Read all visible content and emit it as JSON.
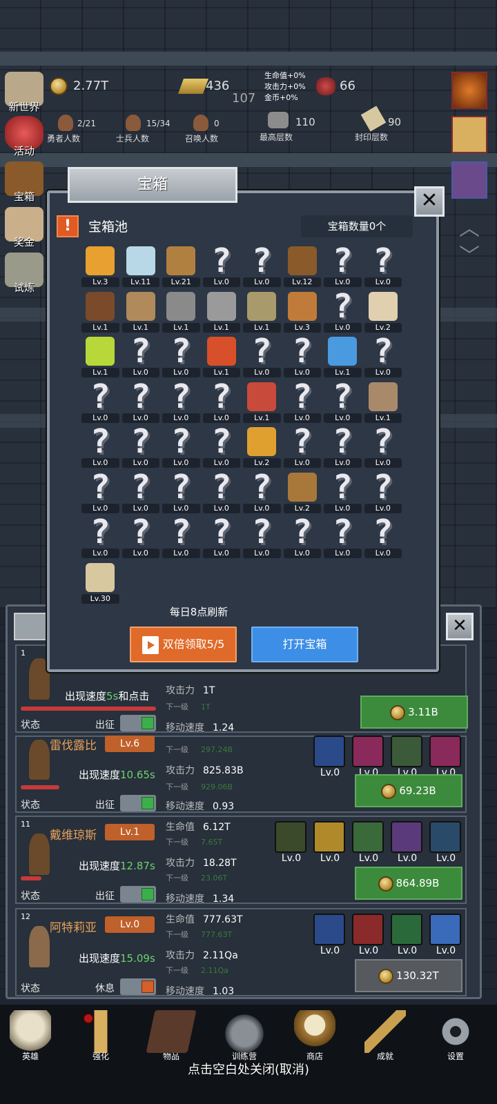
{
  "hud": {
    "gold": "2.77T",
    "bars": "436",
    "gems": "66",
    "mid_number": "107",
    "bonus": [
      "生命值+0%",
      "攻击力+0%",
      "金币+0%"
    ],
    "heroes": {
      "value": "2/21",
      "label": "勇者人数"
    },
    "soldiers": {
      "value": "15/34",
      "label": "士兵人数"
    },
    "summon": {
      "value": "0",
      "label": "召唤人数"
    },
    "max_floor": {
      "value": "110",
      "label": "最高层数"
    },
    "sealed_floor": {
      "value": "90",
      "label": "封印层数"
    }
  },
  "left_nav": [
    "新世界",
    "活动",
    "宝箱",
    "奖金",
    "试炼"
  ],
  "modal": {
    "title": "宝箱",
    "pool_label": "宝箱池",
    "count": "宝箱数量0个",
    "refresh": "每日8点刷新",
    "double_btn": "双倍领取5/5",
    "open_btn": "打开宝箱",
    "items": [
      {
        "icon": "crown-icon",
        "lv": "Lv.3"
      },
      {
        "icon": "diamond-icon",
        "lv": "Lv.11"
      },
      {
        "icon": "wooden-sword-icon",
        "lv": "Lv.21"
      },
      {
        "icon": "unknown-icon",
        "lv": "Lv.0"
      },
      {
        "icon": "unknown-icon",
        "lv": "Lv.0"
      },
      {
        "icon": "leather-armor-icon",
        "lv": "Lv.12"
      },
      {
        "icon": "unknown-icon",
        "lv": "Lv.0"
      },
      {
        "icon": "unknown-icon",
        "lv": "Lv.0"
      },
      {
        "icon": "leather-helmet-icon",
        "lv": "Lv.1"
      },
      {
        "icon": "dagger-icon",
        "lv": "Lv.1"
      },
      {
        "icon": "iron-helmet-icon",
        "lv": "Lv.1"
      },
      {
        "icon": "hammer-icon",
        "lv": "Lv.1"
      },
      {
        "icon": "great-helm-icon",
        "lv": "Lv.1"
      },
      {
        "icon": "meat-icon",
        "lv": "Lv.3"
      },
      {
        "icon": "unknown-icon",
        "lv": "Lv.0"
      },
      {
        "icon": "rice-bowl-icon",
        "lv": "Lv.2"
      },
      {
        "icon": "green-potion-icon",
        "lv": "Lv.1"
      },
      {
        "icon": "unknown-icon",
        "lv": "Lv.0"
      },
      {
        "icon": "unknown-icon",
        "lv": "Lv.0"
      },
      {
        "icon": "red-potion-icon",
        "lv": "Lv.1"
      },
      {
        "icon": "unknown-icon",
        "lv": "Lv.0"
      },
      {
        "icon": "unknown-icon",
        "lv": "Lv.0"
      },
      {
        "icon": "blue-potion-icon",
        "lv": "Lv.1"
      },
      {
        "icon": "unknown-icon",
        "lv": "Lv.0"
      },
      {
        "icon": "unknown-icon",
        "lv": "Lv.0"
      },
      {
        "icon": "unknown-icon",
        "lv": "Lv.0"
      },
      {
        "icon": "unknown-icon",
        "lv": "Lv.0"
      },
      {
        "icon": "unknown-icon",
        "lv": "Lv.0"
      },
      {
        "icon": "red-vial-icon",
        "lv": "Lv.1"
      },
      {
        "icon": "unknown-icon",
        "lv": "Lv.0"
      },
      {
        "icon": "unknown-icon",
        "lv": "Lv.0"
      },
      {
        "icon": "boot-icon",
        "lv": "Lv.1"
      },
      {
        "icon": "unknown-icon",
        "lv": "Lv.0"
      },
      {
        "icon": "unknown-icon",
        "lv": "Lv.0"
      },
      {
        "icon": "unknown-icon",
        "lv": "Lv.0"
      },
      {
        "icon": "unknown-icon",
        "lv": "Lv.0"
      },
      {
        "icon": "torch-icon",
        "lv": "Lv.2"
      },
      {
        "icon": "unknown-icon",
        "lv": "Lv.0"
      },
      {
        "icon": "unknown-icon",
        "lv": "Lv.0"
      },
      {
        "icon": "unknown-icon",
        "lv": "Lv.0"
      },
      {
        "icon": "unknown-icon",
        "lv": "Lv.0"
      },
      {
        "icon": "unknown-icon",
        "lv": "Lv.0"
      },
      {
        "icon": "unknown-icon",
        "lv": "Lv.0"
      },
      {
        "icon": "unknown-icon",
        "lv": "Lv.0"
      },
      {
        "icon": "unknown-icon",
        "lv": "Lv.0"
      },
      {
        "icon": "backpack-icon",
        "lv": "Lv.2"
      },
      {
        "icon": "unknown-icon",
        "lv": "Lv.0"
      },
      {
        "icon": "unknown-icon",
        "lv": "Lv.0"
      },
      {
        "icon": "unknown-icon",
        "lv": "Lv.0"
      },
      {
        "icon": "unknown-icon",
        "lv": "Lv.0"
      },
      {
        "icon": "unknown-icon",
        "lv": "Lv.0"
      },
      {
        "icon": "unknown-icon",
        "lv": "Lv.0"
      },
      {
        "icon": "unknown-icon",
        "lv": "Lv.0"
      },
      {
        "icon": "unknown-icon",
        "lv": "Lv.0"
      },
      {
        "icon": "unknown-icon",
        "lv": "Lv.0"
      },
      {
        "icon": "unknown-icon",
        "lv": "Lv.0"
      },
      {
        "icon": "beer-mug-icon",
        "lv": "Lv.30"
      }
    ]
  },
  "heroes": [
    {
      "num": "1",
      "name": "",
      "lv": "",
      "speed_prefix": "出现速度",
      "speed": "5s",
      "speed_suffix": "和点击",
      "stats": [
        {
          "label": "攻击力",
          "value": "1T"
        },
        {
          "label": "下一级",
          "value": "1T",
          "sub": true
        },
        {
          "label": "移动速度",
          "value": "1.24"
        }
      ],
      "cost": "3.11B",
      "status": "状态",
      "deploy": "出征",
      "on": true
    },
    {
      "num": "",
      "name": "雷伐露比",
      "lv": "Lv.6",
      "speed_prefix": "出现速度",
      "speed": "10.65s",
      "speed_suffix": "",
      "stats": [
        {
          "label": "下一级",
          "value": "297.24B",
          "sub": true
        },
        {
          "label": "攻击力",
          "value": "825.83B"
        },
        {
          "label": "下一级",
          "value": "929.06B",
          "sub": true
        },
        {
          "label": "移动速度",
          "value": "0.93"
        }
      ],
      "skills": [
        "leaf-skill-icon",
        "claw-skill-icon",
        "beast-skill-icon",
        "boot-skill-icon"
      ],
      "skill_lv": "Lv.0",
      "cost": "69.23B",
      "status": "状态",
      "deploy": "出征",
      "on": true
    },
    {
      "num": "11",
      "name": "戴维琼斯",
      "lv": "Lv.1",
      "speed_prefix": "出现速度",
      "speed": "12.87s",
      "speed_suffix": "",
      "stats": [
        {
          "label": "生命值",
          "value": "6.12T"
        },
        {
          "label": "下一级",
          "value": "7.65T",
          "sub": true
        },
        {
          "label": "攻击力",
          "value": "18.28T"
        },
        {
          "label": "下一级",
          "value": "23.06T",
          "sub": true
        },
        {
          "label": "移动速度",
          "value": "1.34"
        }
      ],
      "skills": [
        "skull-shield-skill-icon",
        "blade-skill-icon",
        "boot-skill-icon",
        "claw-skill-icon",
        "fist-skill-icon"
      ],
      "skill_lv": "Lv.0",
      "cost": "864.89B",
      "status": "状态",
      "deploy": "出征",
      "on": true
    },
    {
      "num": "12",
      "name": "阿特莉亚",
      "lv": "Lv.0",
      "speed_prefix": "出现速度",
      "speed": "15.09s",
      "speed_suffix": "",
      "stats": [
        {
          "label": "生命值",
          "value": "777.63T"
        },
        {
          "label": "下一级",
          "value": "777.63T",
          "sub": true
        },
        {
          "label": "攻击力",
          "value": "2.11Qa"
        },
        {
          "label": "下一级",
          "value": "2.11Qa",
          "sub": true
        },
        {
          "label": "移动速度",
          "value": "1.03"
        }
      ],
      "skills": [
        "shield-skill-icon",
        "blood-skill-icon",
        "leaf-skill-icon",
        "heart-skill-icon"
      ],
      "skill_lv": "Lv.0",
      "cost": "130.32T",
      "status": "状态",
      "deploy": "休息",
      "on": false
    }
  ],
  "bottom_nav": [
    "英雄",
    "强化",
    "物品",
    "训练营",
    "商店",
    "成就",
    "设置"
  ],
  "close_hint": "点击空白处关闭(取消)"
}
